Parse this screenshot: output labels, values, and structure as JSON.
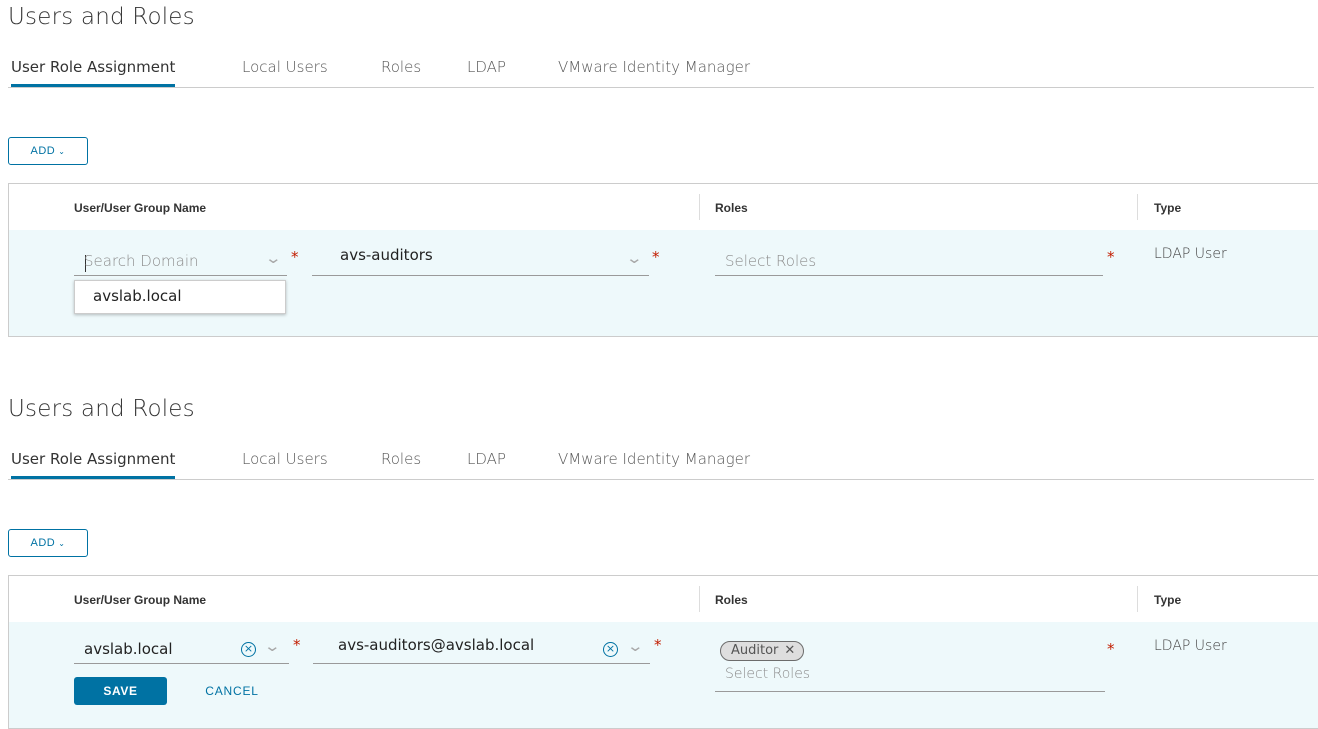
{
  "panel_1": {
    "title": "Users and Roles",
    "tabs": [
      "User Role Assignment",
      "Local Users",
      "Roles",
      "LDAP",
      "VMware Identity Manager"
    ],
    "add_label": "ADD",
    "columns": [
      "User/User Group Name",
      "Roles",
      "Type"
    ],
    "row": {
      "domain_placeholder": "Search Domain",
      "user_value": "avs-auditors",
      "roles_placeholder": "Select Roles",
      "type": "LDAP User",
      "required_mark": "*"
    },
    "dropdown_options": [
      "avslab.local"
    ]
  },
  "panel_2": {
    "title": "Users and Roles",
    "tabs": [
      "User Role Assignment",
      "Local Users",
      "Roles",
      "LDAP",
      "VMware Identity Manager"
    ],
    "add_label": "ADD",
    "columns": [
      "User/User Group Name",
      "Roles",
      "Type"
    ],
    "row": {
      "domain_value": "avslab.local",
      "user_value": "avs-auditors@avslab.local",
      "role_chips": [
        "Auditor"
      ],
      "roles_placeholder": "Select Roles",
      "type": "LDAP User",
      "required_mark": "*"
    },
    "save_label": "SAVE",
    "cancel_label": "CANCEL"
  },
  "icons": {
    "chevron": "chevron-down-icon",
    "clear": "clear-circle-icon",
    "chip_close": "close-icon"
  },
  "colors": {
    "accent": "#0072a3",
    "row_highlight": "#eef9fb",
    "required": "#c21d00"
  }
}
